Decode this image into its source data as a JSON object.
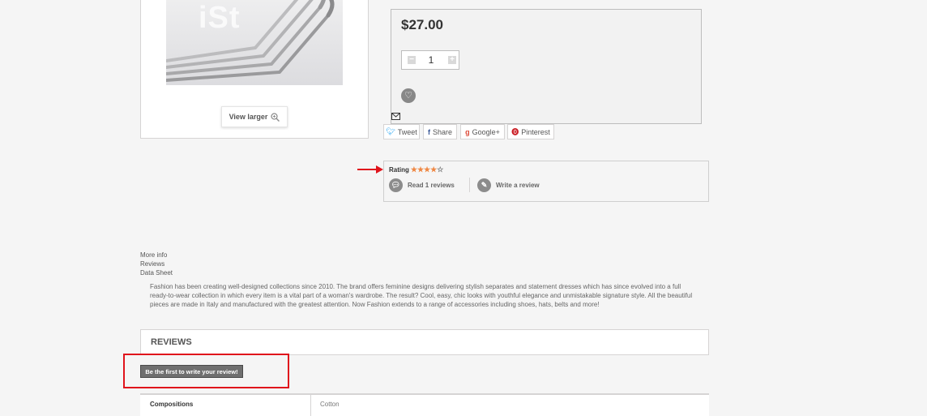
{
  "product": {
    "watermark": "iSt",
    "view_larger": "View larger",
    "price": "$27.00",
    "quantity": "1"
  },
  "share": {
    "tweet": "Tweet",
    "share": "Share",
    "google": "Google+",
    "pinterest": "Pinterest"
  },
  "rating": {
    "label": "Rating",
    "stars": 4,
    "max": 5,
    "read_reviews": "Read 1 reviews",
    "write_review": "Write a review"
  },
  "tabs": [
    "More info",
    "Reviews",
    "Data Sheet"
  ],
  "description": "Fashion has been creating well-designed collections since 2010. The brand offers feminine designs delivering stylish separates and statement dresses which has since evolved into a full ready-to-wear collection in which every item is a vital part of a woman's wardrobe. The result? Cool, easy, chic looks with youthful elegance and unmistakable signature style. All the beautiful pieces are made in Italy and manufactured with the greatest attention. Now Fashion extends to a range of accessories including shoes, hats, belts and more!",
  "reviews": {
    "title": "REVIEWS",
    "first_review_button": "Be the first to write your review!"
  },
  "data_sheet": {
    "key": "Compositions",
    "value": "Cotton"
  },
  "colors": {
    "star": "#ef8743",
    "annotation": "#e0141c"
  }
}
